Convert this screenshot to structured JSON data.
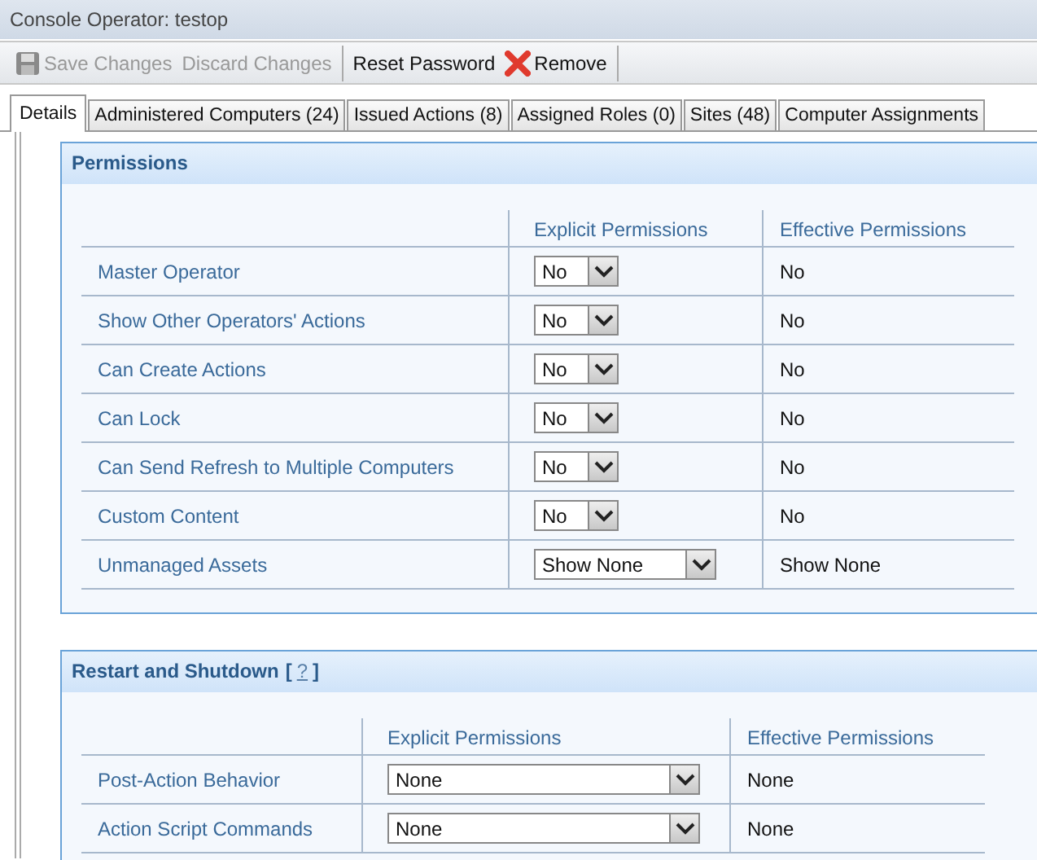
{
  "window": {
    "title": "Console Operator: testop"
  },
  "toolbar": [
    {
      "label": "Save Changes",
      "disabled": true
    },
    {
      "label": "Discard Changes",
      "disabled": true
    },
    {
      "label": "Reset Password",
      "disabled": false
    },
    {
      "label": "Remove",
      "disabled": false
    }
  ],
  "tabs": [
    {
      "label": "Details",
      "selected": true
    },
    {
      "label": "Administered Computers (24)",
      "selected": false
    },
    {
      "label": "Issued Actions (8)",
      "selected": false
    },
    {
      "label": "Assigned Roles (0)",
      "selected": false
    },
    {
      "label": "Sites (48)",
      "selected": false
    },
    {
      "label": "Computer Assignments",
      "selected": false
    }
  ],
  "sections": [
    {
      "title": "Permissions",
      "columns": [
        "Explicit Permissions",
        "Effective Permissions"
      ],
      "rows": [
        {
          "label": "Master Operator",
          "explicit": "No",
          "effective": "No",
          "kind": "short"
        },
        {
          "label": "Show Other Operators' Actions",
          "explicit": "No",
          "effective": "No",
          "kind": "short"
        },
        {
          "label": "Can Create Actions",
          "explicit": "No",
          "effective": "No",
          "kind": "short"
        },
        {
          "label": "Can Lock",
          "explicit": "No",
          "effective": "No",
          "kind": "short"
        },
        {
          "label": "Can Send Refresh to Multiple Computers",
          "explicit": "No",
          "effective": "No",
          "kind": "short"
        },
        {
          "label": "Custom Content",
          "explicit": "No",
          "effective": "No",
          "kind": "short"
        },
        {
          "label": "Unmanaged Assets",
          "explicit": "Show None",
          "effective": "Show None",
          "kind": "medium"
        }
      ]
    },
    {
      "title": "Restart and Shutdown",
      "help": {
        "open": "[",
        "link": "?",
        "close": "]"
      },
      "columns": [
        "Explicit Permissions",
        "Effective Permissions"
      ],
      "rows": [
        {
          "label": "Post-Action Behavior",
          "explicit": "None",
          "effective": "None",
          "kind": "long"
        },
        {
          "label": "Action Script Commands",
          "explicit": "None",
          "effective": "None",
          "kind": "long"
        }
      ]
    }
  ]
}
